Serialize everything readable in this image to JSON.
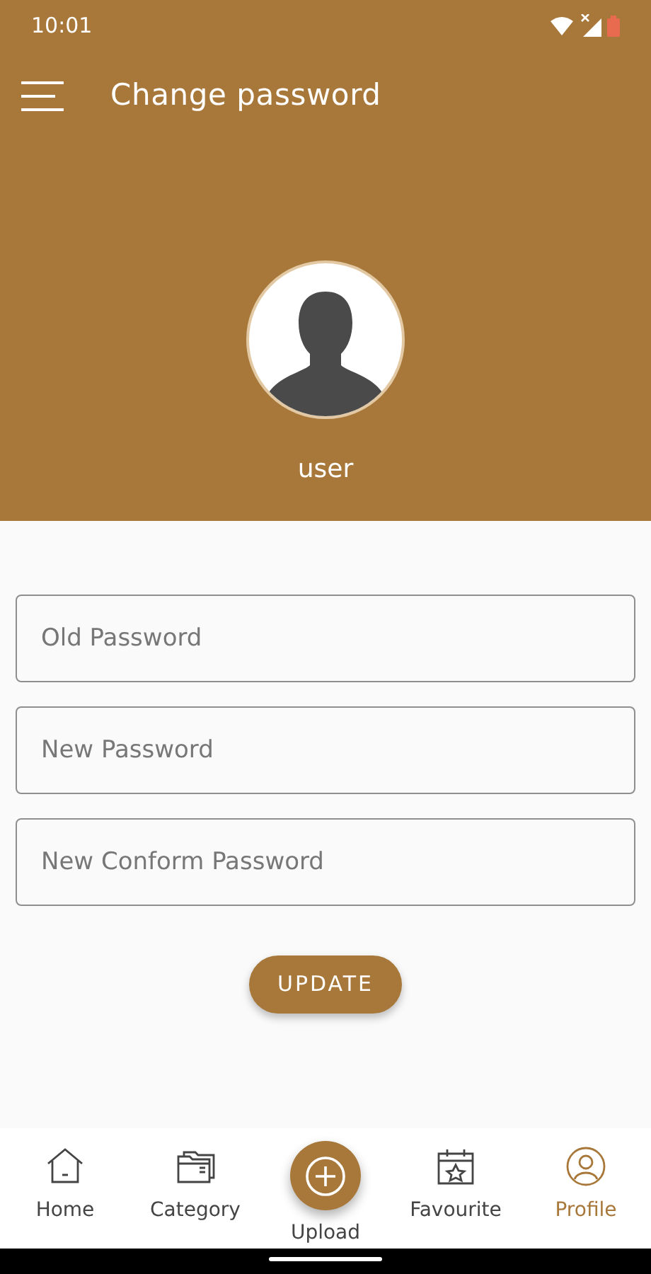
{
  "status_bar": {
    "time": "10:01"
  },
  "app_bar": {
    "title": "Change password"
  },
  "profile": {
    "username": "user"
  },
  "form": {
    "fields": [
      {
        "placeholder": "Old Password"
      },
      {
        "placeholder": "New Password"
      },
      {
        "placeholder": "New Conform Password"
      }
    ],
    "submit": "UPDATE"
  },
  "bottom_nav": [
    {
      "label": "Home",
      "kind": "tab",
      "selected": false
    },
    {
      "label": "Category",
      "kind": "tab",
      "selected": false
    },
    {
      "label": "Upload",
      "kind": "fab",
      "selected": false
    },
    {
      "label": "Favourite",
      "kind": "tab",
      "selected": false
    },
    {
      "label": "Profile",
      "kind": "tab",
      "selected": true
    }
  ]
}
